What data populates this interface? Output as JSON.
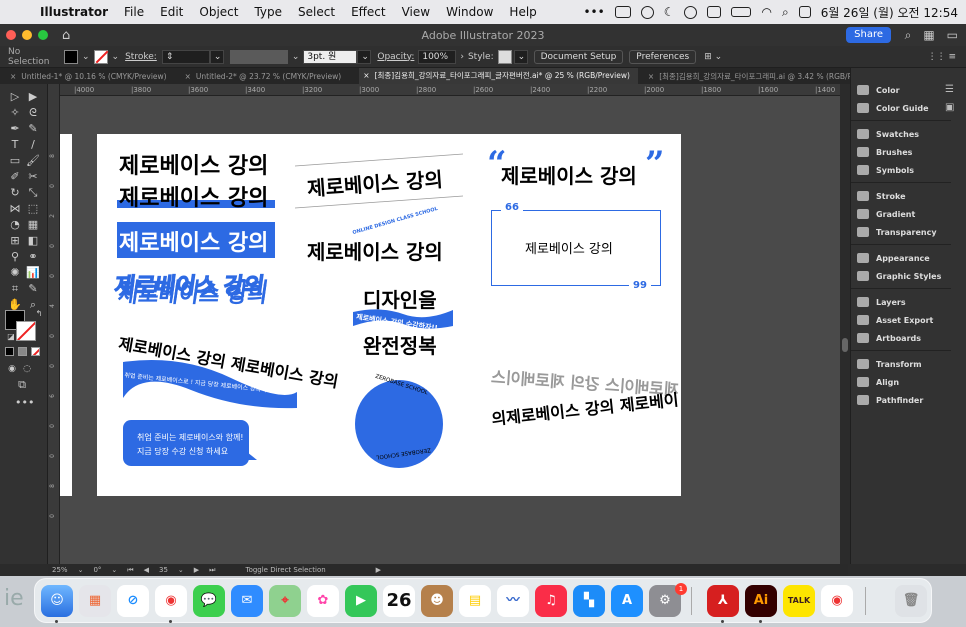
{
  "menubar": {
    "app": "Illustrator",
    "items": [
      "File",
      "Edit",
      "Object",
      "Type",
      "Select",
      "Effect",
      "View",
      "Window",
      "Help"
    ],
    "datetime": "6월 26일 (월) 오전 12:54"
  },
  "window": {
    "title": "Adobe Illustrator 2023",
    "share_label": "Share"
  },
  "controlbar": {
    "selection": "No Selection",
    "stroke_label": "Stroke:",
    "brush": "3pt. 원",
    "opacity_label": "Opacity:",
    "opacity_value": "100%",
    "style_label": "Style:",
    "document_setup": "Document Setup",
    "preferences": "Preferences"
  },
  "tabs": [
    "Untitled-1* @ 10.16 % (CMYK/Preview)",
    "Untitled-2* @ 23.72 % (CMYK/Preview)",
    "[최종]김용희_강의자료_타이포그래피_글자편버전.ai* @ 25 % (RGB/Preview)",
    "[최종]김용희_강의자료_타이포그래피.ai @ 3.42 % (RGB/Preview)"
  ],
  "ruler": [
    "4000",
    "3800",
    "3600",
    "3400",
    "3200",
    "3000",
    "2800",
    "2600",
    "2400",
    "2200",
    "2000",
    "1800",
    "1600",
    "1400"
  ],
  "vruler": [
    "8",
    "0",
    "2",
    "0",
    "0",
    "4",
    "0",
    "0",
    "6",
    "0",
    "0",
    "8",
    "0"
  ],
  "panels": [
    "Color",
    "Color Guide",
    "Swatches",
    "Brushes",
    "Symbols",
    "Stroke",
    "Gradient",
    "Transparency",
    "Appearance",
    "Graphic Styles",
    "Layers",
    "Asset Export",
    "Artboards",
    "Transform",
    "Align",
    "Pathfinder"
  ],
  "statusbar": {
    "zoom": "25%",
    "rotation": "0°",
    "artboard": "35",
    "tool": "Toggle Direct Selection"
  },
  "artboard": {
    "text_main": "제로베이스 강의",
    "online_design": "ONLINE DESIGN CLASS SCHOOL",
    "design_title1": "디자인을",
    "design_ribbon": "제로베이스 강의 수강하자!!",
    "design_title2": "완전정복",
    "quote_open": "“",
    "quote_close": "”",
    "box_quote_open": "66",
    "box_quote_close": "99",
    "wave_line": "제로베이스 강의 제로베이스 강의",
    "ribbon_text": "취업 준비는 제로베이스로 ! 지금 당장 제로베이스 강의 수강하자",
    "bubble_line1": "취업 준비는 제로베이스와 함께!",
    "bubble_line2": "지금 당장 수강 신청 하세요",
    "circle_top": "ZEROBASE SCHOOL",
    "circle_bottom": "ZEROBASE SCHOOL",
    "ring_back": "제로베이스 강의 제로베이스",
    "ring_front": "의제로베이스 강의 제로베이"
  },
  "dock": {
    "partial_text": "ie",
    "calendar_day": "26",
    "settings_badge": "1",
    "ai_label": "Ai",
    "talk_label": "TALK"
  },
  "colors": {
    "accent": "#2d6ae3",
    "menubar": "#e9e9ec"
  }
}
